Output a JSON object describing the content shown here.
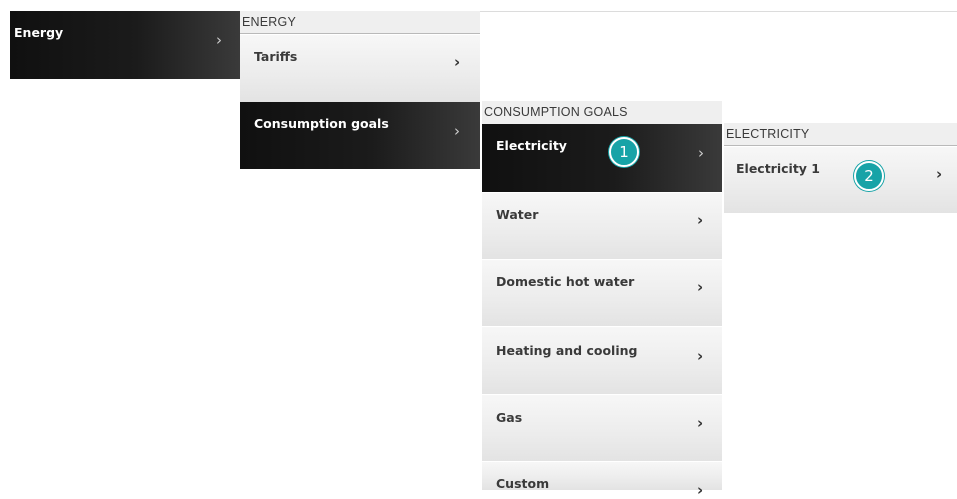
{
  "energy_panel": {
    "tile_label": "Energy",
    "chevron": "›"
  },
  "energy_menu": {
    "header": "ENERGY",
    "items": [
      {
        "label": "Tariffs",
        "chevron": "›"
      },
      {
        "label": "Consumption goals",
        "chevron": "›",
        "selected": true
      }
    ]
  },
  "consumption_goals_menu": {
    "header": "CONSUMPTION GOALS",
    "items": [
      {
        "label": "Electricity",
        "chevron": "›",
        "selected": true
      },
      {
        "label": "Water",
        "chevron": "›"
      },
      {
        "label": "Domestic hot water",
        "chevron": "›"
      },
      {
        "label": "Heating and cooling",
        "chevron": "›"
      },
      {
        "label": "Gas",
        "chevron": "›"
      },
      {
        "label": "Custom",
        "chevron": "›"
      }
    ]
  },
  "electricity_menu": {
    "header": "ELECTRICITY",
    "items": [
      {
        "label": "Electricity 1",
        "chevron": "›"
      }
    ]
  },
  "callouts": [
    "1",
    "2"
  ],
  "colors": {
    "selected_tile": "#101010",
    "tile": "#ececec",
    "callout": "#17a3a7"
  }
}
